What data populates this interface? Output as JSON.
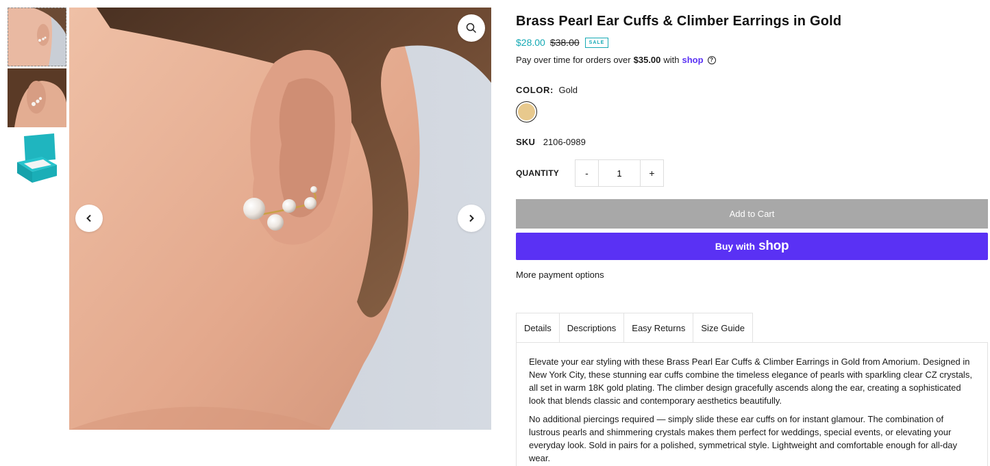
{
  "thumbnails": [
    {
      "name": "thumb-ear-profile",
      "icon": "ear-cuff-photo"
    },
    {
      "name": "thumb-ear-closeup",
      "icon": "ear-cuff-closeup-photo"
    },
    {
      "name": "thumb-gift-box",
      "icon": "teal-gift-box-photo"
    }
  ],
  "product": {
    "title": "Brass Pearl Ear Cuffs & Climber Earrings in Gold",
    "price_sale": "$28.00",
    "price_compare": "$38.00",
    "sale_badge": "SALE",
    "installments_prefix": "Pay over time for orders over",
    "installments_amount": "$35.00",
    "installments_with": "with",
    "installments_brand": "shop",
    "color_label": "COLOR:",
    "color_value": "Gold",
    "swatch_color": "#e8c98d",
    "sku_label": "SKU",
    "sku_value": "2106-0989",
    "quantity_label": "QUANTITY",
    "quantity_minus": "-",
    "quantity_plus": "+",
    "quantity_value": "1",
    "add_to_cart": "Add to Cart",
    "buy_with": "Buy with",
    "buy_brand": "shop",
    "more_payment": "More payment options"
  },
  "tabs": [
    {
      "label": "Details"
    },
    {
      "label": "Descriptions"
    },
    {
      "label": "Easy Returns"
    },
    {
      "label": "Size Guide"
    }
  ],
  "details": {
    "paragraph_1": "Elevate your ear styling with these Brass Pearl Ear Cuffs & Climber Earrings in Gold from Amorium. Designed in New York City, these stunning ear cuffs combine the timeless elegance of pearls with sparkling clear CZ crystals, all set in warm 18K gold plating. The climber design gracefully ascends along the ear, creating a sophisticated look that blends classic and contemporary aesthetics beautifully.",
    "paragraph_2": "No additional piercings required — simply slide these ear cuffs on for instant glamour. The combination of lustrous pearls and shimmering crystals makes them perfect for weddings, special events, or elevating your everyday look. Sold in pairs for a polished, symmetrical style. Lightweight and comfortable enough for all-day wear."
  },
  "colors": {
    "accent_teal": "#14a9b4",
    "shop_purple": "#5a31f4",
    "add_to_cart_gray": "#a8a8a8"
  }
}
